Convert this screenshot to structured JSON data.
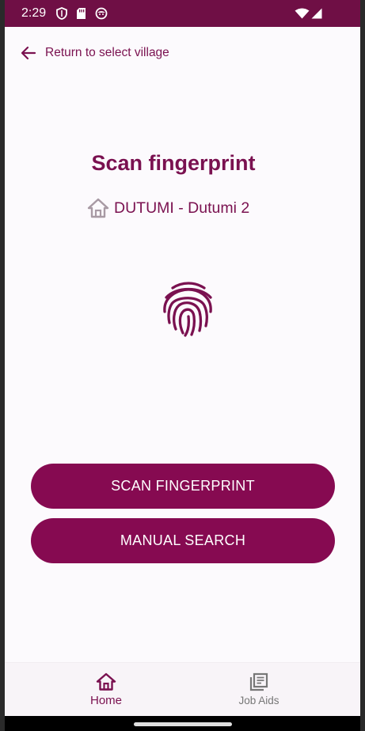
{
  "status_bar": {
    "time": "2:29",
    "icons": [
      "shield-icon",
      "sd-card-icon",
      "face-icon",
      "wifi-icon",
      "signal-icon"
    ]
  },
  "header": {
    "back_label": "Return to select village"
  },
  "main": {
    "title": "Scan fingerprint",
    "village": "DUTUMI - Dutumi 2",
    "village_icon": "home-icon",
    "illustration": "fingerprint-icon"
  },
  "actions": {
    "scan_label": "SCAN FINGERPRINT",
    "manual_label": "MANUAL SEARCH"
  },
  "bottom_nav": {
    "items": [
      {
        "label": "Home",
        "icon": "home-icon",
        "active": true
      },
      {
        "label": "Job Aids",
        "icon": "library-icon",
        "active": false
      }
    ]
  },
  "colors": {
    "primary": "#860a51",
    "status_bar": "#6f0f45",
    "text_primary": "#7a1150",
    "background": "#fcfafd",
    "inactive": "#777777"
  }
}
